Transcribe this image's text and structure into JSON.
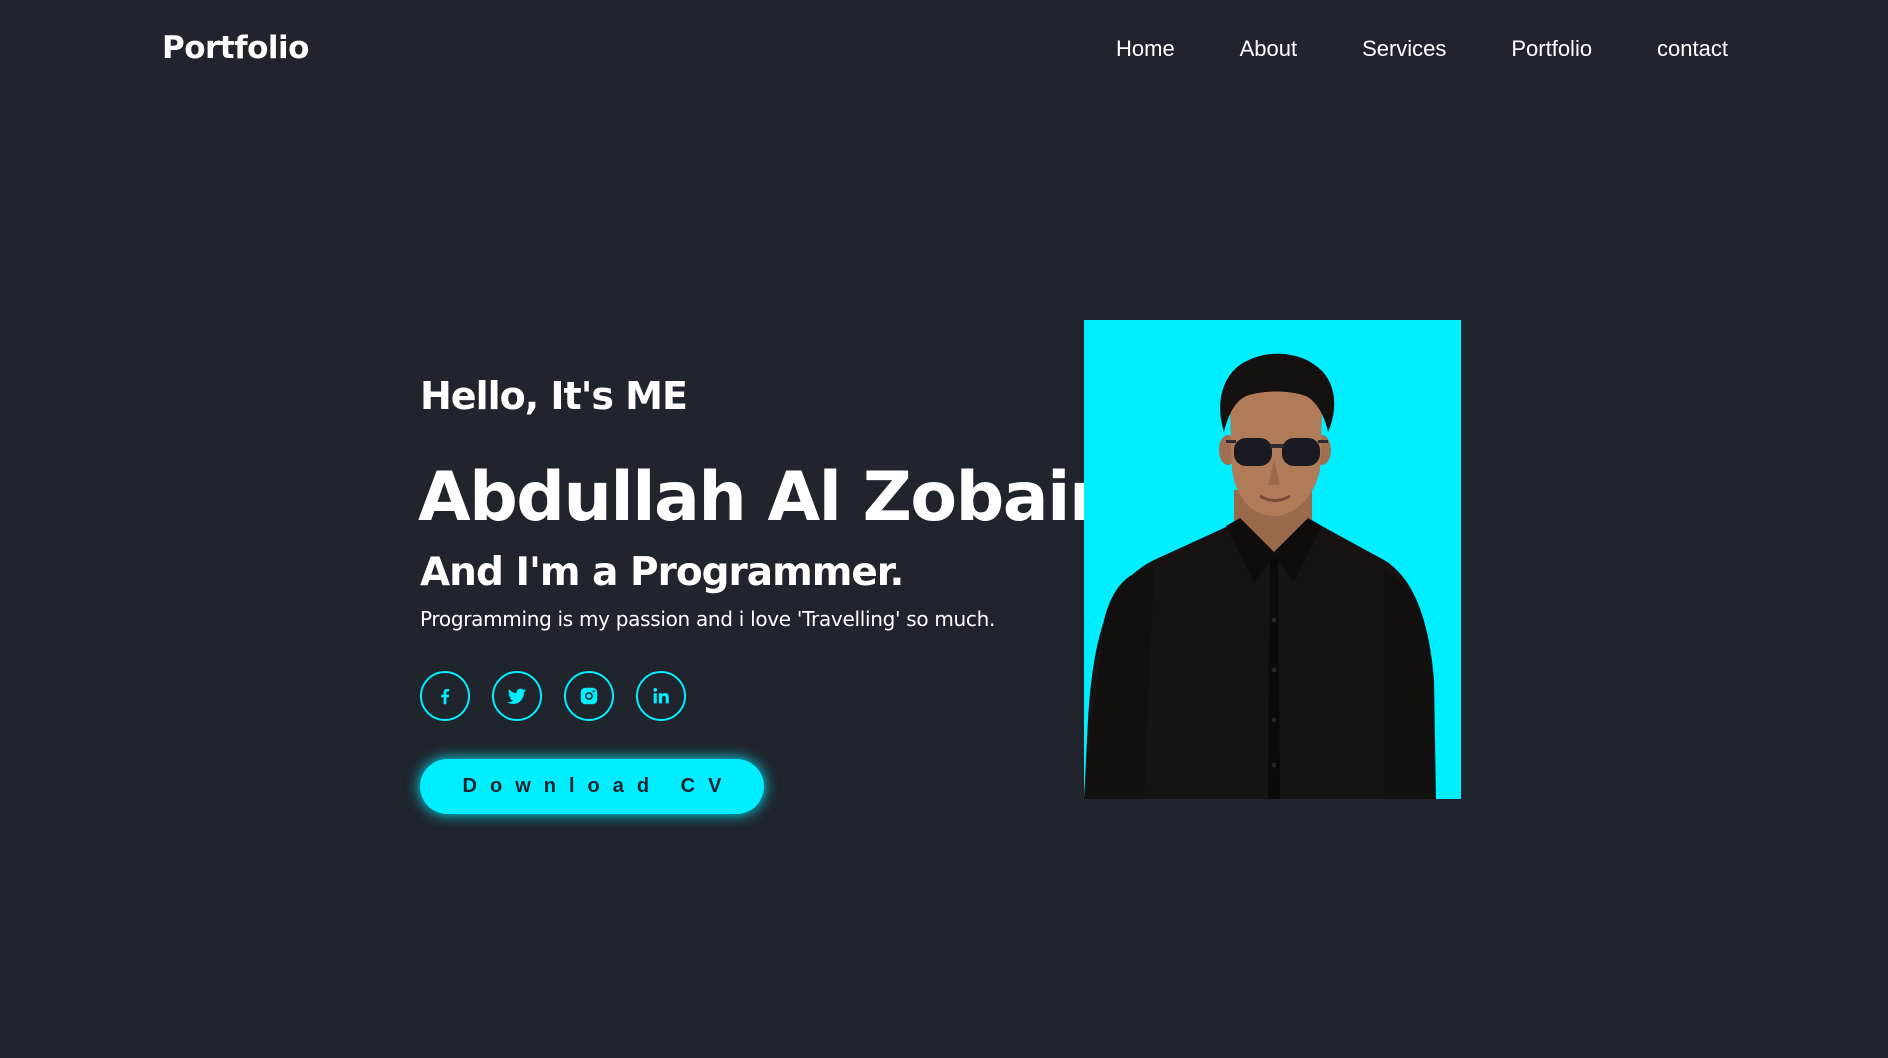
{
  "brand": {
    "logo": "Portfolio"
  },
  "nav": {
    "items": [
      {
        "label": "Home"
      },
      {
        "label": "About"
      },
      {
        "label": "Services"
      },
      {
        "label": "Portfolio"
      },
      {
        "label": "contact"
      }
    ]
  },
  "hero": {
    "greeting": "Hello, It's ME",
    "name": "Abdullah Al Zobair",
    "role": "And I'm a Programmer.",
    "tagline": "Programming is my passion and i love 'Travelling' so much.",
    "cv_button": "Download CV"
  },
  "socials": [
    {
      "icon": "facebook-icon"
    },
    {
      "icon": "twitter-icon"
    },
    {
      "icon": "instagram-icon"
    },
    {
      "icon": "linkedin-icon"
    }
  ],
  "colors": {
    "background": "#1f242d",
    "accent": "#00eeff",
    "text": "#ffffff"
  }
}
